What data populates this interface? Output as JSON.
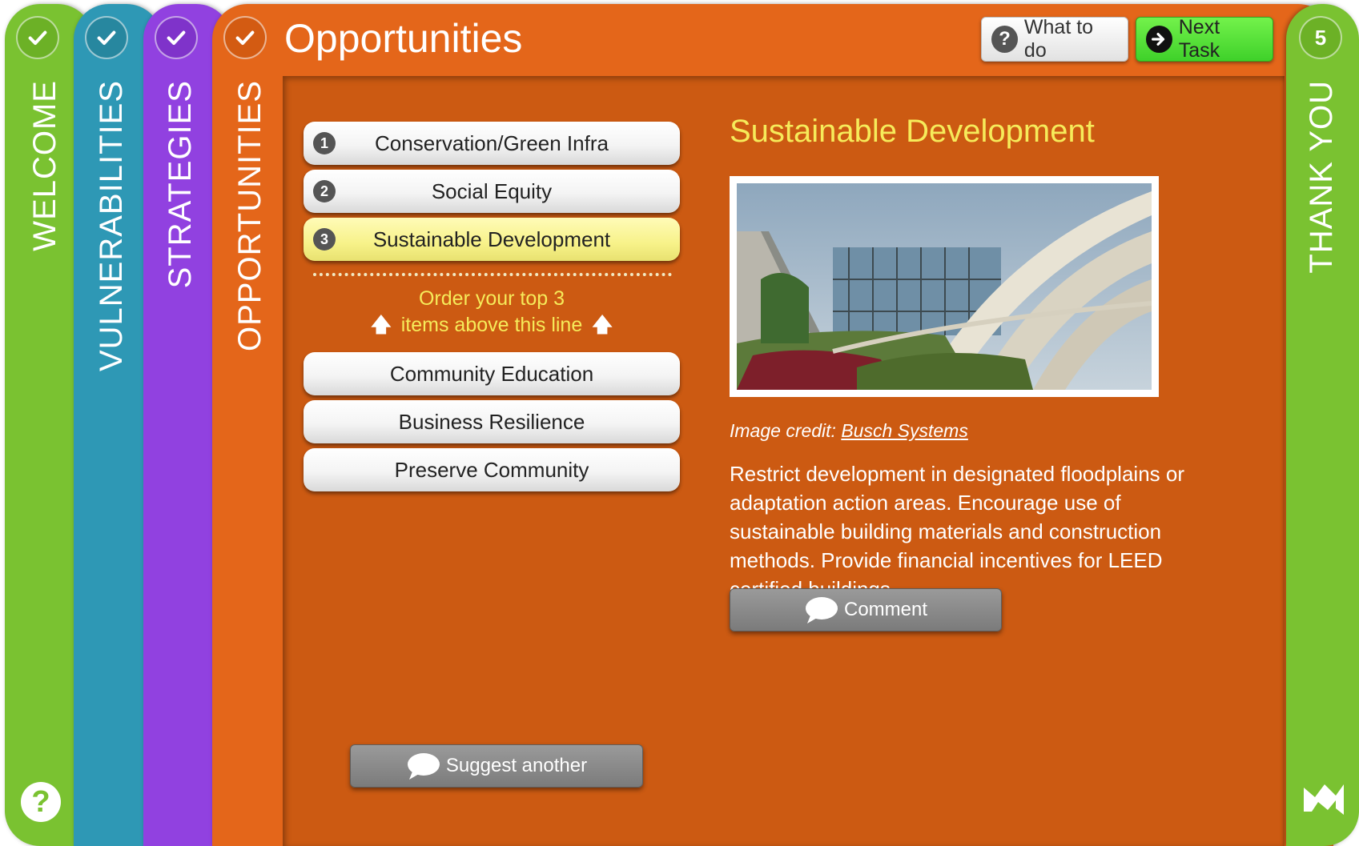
{
  "tabs": {
    "welcome": "WELCOME",
    "vulnerabilities": "VULNERABILITIES",
    "strategies": "STRATEGIES",
    "opportunities": "OPPORTUNITIES",
    "thank_you": "THANK YOU",
    "thank_you_step": "5"
  },
  "header": {
    "title": "Opportunities",
    "what_to_do_label": "What to do",
    "next_task_label": "Next Task"
  },
  "ranked_items": [
    {
      "rank": "1",
      "label": "Conservation/Green Infra"
    },
    {
      "rank": "2",
      "label": "Social Equity"
    },
    {
      "rank": "3",
      "label": "Sustainable Development"
    }
  ],
  "order_hint": {
    "line1": "Order your top 3",
    "line2": "items above this line"
  },
  "unranked_items": [
    {
      "label": "Community Education"
    },
    {
      "label": "Business Resilience"
    },
    {
      "label": "Preserve Community"
    }
  ],
  "suggest_label": "Suggest another",
  "detail": {
    "title": "Sustainable Development",
    "credit_prefix": "Image credit:",
    "credit_link": "Busch Systems",
    "description": "Restrict development in designated floodplains or adaptation action areas. Encourage use of sustainable building materials and construction methods. Provide financial incentives for LEED certified buildings.",
    "comment_label": "Comment"
  },
  "colors": {
    "welcome": "#7ac231",
    "vulnerabilities": "#2e98b5",
    "strategies": "#9141e0",
    "opportunities": "#e4661a",
    "panel": "#cc5a12",
    "highlight_text": "#f6eb5a",
    "selected_item": "#f7f289",
    "next_task": "#3fd12a"
  }
}
